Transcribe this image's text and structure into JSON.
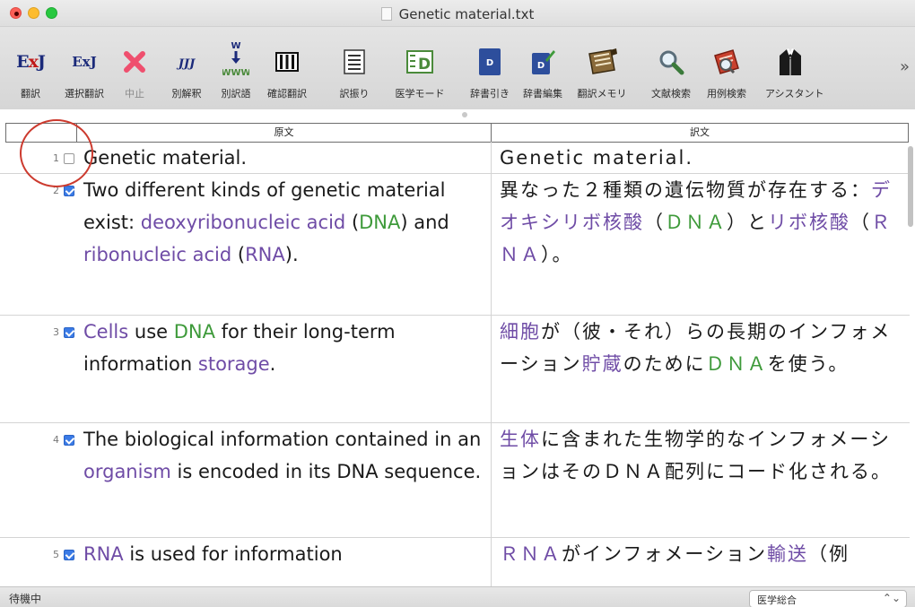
{
  "window": {
    "title": "Genetic material.txt"
  },
  "toolbar": {
    "buttons": [
      {
        "label": "翻訳"
      },
      {
        "label": "選択翻訳"
      },
      {
        "label": "中止"
      },
      {
        "label": "別解釈"
      },
      {
        "label": "別訳語"
      },
      {
        "label": "確認翻訳"
      },
      {
        "label": "訳振り"
      },
      {
        "label": "医学モード"
      },
      {
        "label": "辞書引き"
      },
      {
        "label": "辞書編集"
      },
      {
        "label": "翻訳メモリ"
      },
      {
        "label": "文献検索"
      },
      {
        "label": "用例検索"
      },
      {
        "label": "アシスタント"
      }
    ],
    "icon_texts": {
      "exj": "ExJ",
      "jj": "J",
      "d": "D",
      "www": "WWW"
    },
    "overflow": "»"
  },
  "columns": {
    "source": "原文",
    "target": "訳文"
  },
  "rows": [
    {
      "num": "1",
      "checked": false,
      "src": [
        {
          "t": "Genetic material."
        }
      ],
      "tgt": [
        {
          "t": "Genetic material."
        }
      ]
    },
    {
      "num": "2",
      "checked": true,
      "src": [
        {
          "t": "Two different kinds of genetic material exist: "
        },
        {
          "t": "deoxyribonucleic acid",
          "c": "p"
        },
        {
          "t": " ("
        },
        {
          "t": "DNA",
          "c": "g"
        },
        {
          "t": ") and "
        },
        {
          "t": "ribonucleic acid",
          "c": "p"
        },
        {
          "t": " ("
        },
        {
          "t": "RNA",
          "c": "p"
        },
        {
          "t": ")."
        }
      ],
      "tgt": [
        {
          "t": "異なった２種類の遺伝物質が存在する："
        },
        {
          "t": "デオキシリボ核酸",
          "c": "p"
        },
        {
          "t": "（"
        },
        {
          "t": "ＤＮＡ",
          "c": "g"
        },
        {
          "t": "）と"
        },
        {
          "t": "リボ核酸",
          "c": "p"
        },
        {
          "t": "（"
        },
        {
          "t": "ＲＮＡ",
          "c": "p"
        },
        {
          "t": "）。"
        }
      ]
    },
    {
      "num": "3",
      "checked": true,
      "src": [
        {
          "t": "Cells",
          "c": "p"
        },
        {
          "t": " use "
        },
        {
          "t": "DNA",
          "c": "g"
        },
        {
          "t": " for their long-term information "
        },
        {
          "t": "storage",
          "c": "p"
        },
        {
          "t": "."
        }
      ],
      "tgt": [
        {
          "t": "細胞",
          "c": "p"
        },
        {
          "t": "が（彼・それ）らの長期のインフォメーション"
        },
        {
          "t": "貯蔵",
          "c": "p"
        },
        {
          "t": "のために"
        },
        {
          "t": "ＤＮＡ",
          "c": "g"
        },
        {
          "t": "を使う。"
        }
      ]
    },
    {
      "num": "4",
      "checked": true,
      "src": [
        {
          "t": "The biological information contained in an "
        },
        {
          "t": "organism",
          "c": "p"
        },
        {
          "t": " is encoded in its DNA sequence."
        }
      ],
      "tgt": [
        {
          "t": "生体",
          "c": "p"
        },
        {
          "t": "に含まれた生物学的なインフォメーションはそのＤＮＡ配列にコード化される。"
        }
      ]
    },
    {
      "num": "5",
      "checked": true,
      "src": [
        {
          "t": "RNA",
          "c": "p"
        },
        {
          "t": " is used for information"
        }
      ],
      "tgt": [
        {
          "t": "ＲＮＡ",
          "c": "p"
        },
        {
          "t": "がインフォメーション"
        },
        {
          "t": "輸送",
          "c": "p"
        },
        {
          "t": "（例"
        }
      ]
    }
  ],
  "status": {
    "text": "待機中",
    "dictionary": "医学総合",
    "dictionary_arrows": "⌃⌄"
  },
  "colors": {
    "term_purple": "#6f4ca6",
    "term_green": "#3e9a3a",
    "annotation_circle": "#cc3a2e"
  }
}
